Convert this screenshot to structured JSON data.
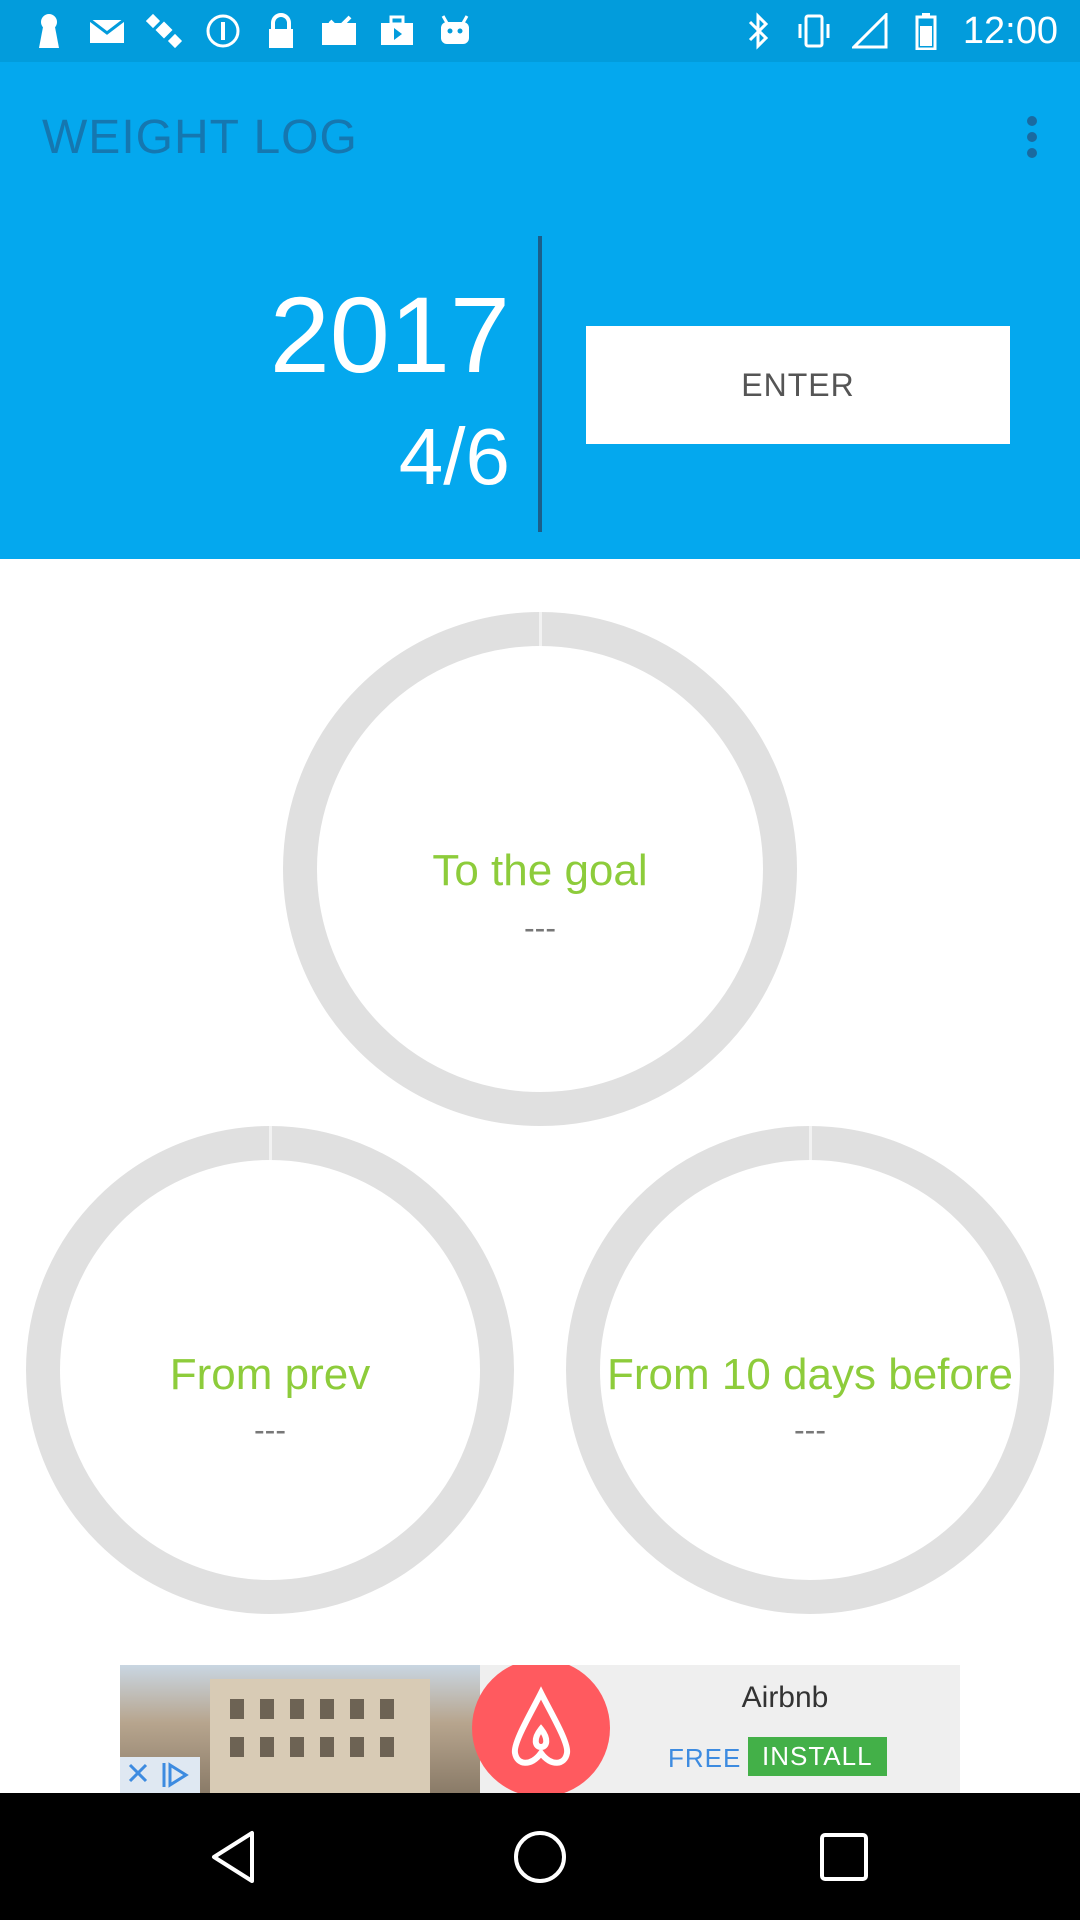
{
  "status_bar": {
    "time": "12:00",
    "left_icons": [
      "keyhole-icon",
      "mail-icon",
      "satellite-icon",
      "info-icon",
      "lock-icon",
      "inbox-icon",
      "briefcase-icon",
      "android-icon"
    ],
    "right_icons": [
      "bluetooth-icon",
      "vibrate-icon",
      "no-signal-icon",
      "battery-icon"
    ]
  },
  "header": {
    "title": "WEIGHT LOG",
    "year": "2017",
    "date": "4/6",
    "enter_label": "ENTER",
    "menu_icon": "more-vert-icon",
    "background": "#04a8ee"
  },
  "circles": {
    "goal": {
      "label": "To the goal",
      "value": "---"
    },
    "prev": {
      "label": "From prev",
      "value": "---"
    },
    "ten_days": {
      "label": "From 10 days before",
      "value": "---"
    }
  },
  "ad": {
    "brand": "Airbnb",
    "free": "FREE",
    "install": "INSTALL",
    "logo_color": "#ff5a5f"
  },
  "colors": {
    "label_green": "#8dcc3b",
    "ring_gray": "#e0e0e0"
  }
}
